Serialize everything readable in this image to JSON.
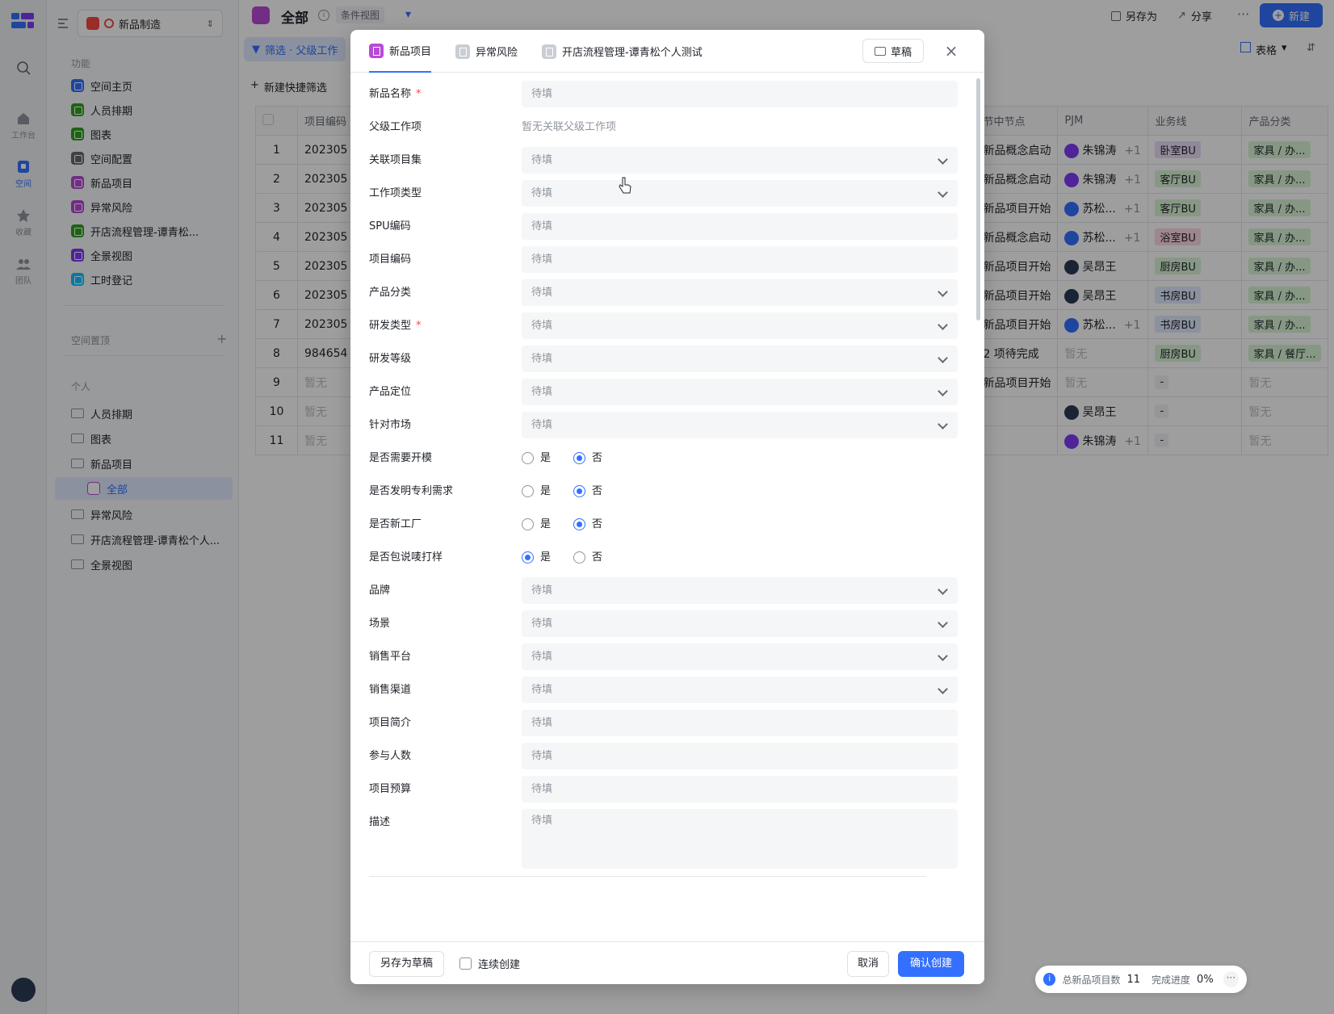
{
  "rail": {
    "items": [
      {
        "label": "工作台"
      },
      {
        "label": "空间"
      },
      {
        "label": "收藏"
      },
      {
        "label": "团队"
      }
    ]
  },
  "sidebar": {
    "workspace": "新品制造",
    "section_features": "功能",
    "features": [
      {
        "label": "空间主页",
        "color": "#3370ff"
      },
      {
        "label": "人员排期",
        "color": "#2ea121"
      },
      {
        "label": "图表",
        "color": "#2ea121"
      },
      {
        "label": "空间配置",
        "color": "#646a73"
      },
      {
        "label": "新品项目",
        "color": "#b84ad6"
      },
      {
        "label": "异常风险",
        "color": "#b84ad6"
      },
      {
        "label": "开店流程管理-谭青松...",
        "color": "#2ea121"
      },
      {
        "label": "全景视图",
        "color": "#7f3bf5"
      },
      {
        "label": "工时登记",
        "color": "#14c0ff"
      }
    ],
    "section_pinned": "空间置顶",
    "section_personal": "个人",
    "personal": [
      {
        "label": "人员排期"
      },
      {
        "label": "图表"
      },
      {
        "label": "新品项目"
      },
      {
        "label": "全部"
      },
      {
        "label": "异常风险"
      },
      {
        "label": "开店流程管理-谭青松个人..."
      },
      {
        "label": "全景视图"
      }
    ]
  },
  "header": {
    "title": "全部",
    "view_tag": "条件视图",
    "save_as": "另存为",
    "share": "分享",
    "new_btn": "新建",
    "filter": "筛选 · 父级工作",
    "quick_filter": "新建快捷筛选",
    "view_mode": "表格"
  },
  "table": {
    "headers": [
      "项目编码",
      "节中节点",
      "PJM",
      "业务线",
      "产品分类"
    ],
    "rows": [
      {
        "n": "1",
        "code": "202305",
        "node": "新品概念启动",
        "pjm": "朱锦涛",
        "plus": "+1",
        "bu": "卧室BU",
        "cat": "家具 / 办..."
      },
      {
        "n": "2",
        "code": "202305",
        "node": "新品概念启动",
        "pjm": "朱锦涛",
        "plus": "+1",
        "bu": "客厅BU",
        "cat": "家具 / 办..."
      },
      {
        "n": "3",
        "code": "202305",
        "node": "新品项目开始",
        "pjm": "苏松...",
        "plus": "+1",
        "bu": "客厅BU",
        "cat": "家具 / 办..."
      },
      {
        "n": "4",
        "code": "202305",
        "node": "新品概念启动",
        "pjm": "苏松...",
        "plus": "+1",
        "bu": "浴室BU",
        "cat": "家具 / 办..."
      },
      {
        "n": "5",
        "code": "202305",
        "node": "新品项目开始",
        "pjm": "吴昂王",
        "plus": "",
        "bu": "厨房BU",
        "cat": "家具 / 办..."
      },
      {
        "n": "6",
        "code": "202305",
        "node": "新品项目开始",
        "pjm": "吴昂王",
        "plus": "",
        "bu": "书房BU",
        "cat": "家具 / 办..."
      },
      {
        "n": "7",
        "code": "202305",
        "node": "新品项目开始",
        "pjm": "苏松...",
        "plus": "+1",
        "bu": "书房BU",
        "cat": "家具 / 办..."
      },
      {
        "n": "8",
        "code": "984654",
        "node": "2 项待完成",
        "pjm": "暂无",
        "plus": "",
        "bu": "厨房BU",
        "cat": "家具 / 餐厅..."
      },
      {
        "n": "9",
        "code": "暂无",
        "node": "新品项目开始",
        "pjm": "暂无",
        "plus": "",
        "bu": "-",
        "cat": "暂无"
      },
      {
        "n": "10",
        "code": "暂无",
        "node": "",
        "pjm": "吴昂王",
        "plus": "",
        "bu": "-",
        "cat": "暂无"
      },
      {
        "n": "11",
        "code": "暂无",
        "node": "",
        "pjm": "朱锦涛",
        "plus": "+1",
        "bu": "-",
        "cat": "暂无"
      }
    ]
  },
  "modal": {
    "tabs": [
      {
        "label": "新品项目",
        "color": "#b84ad6"
      },
      {
        "label": "异常风险",
        "color": "#c9cdd4"
      },
      {
        "label": "开店流程管理-谭青松个人测试",
        "color": "#c9cdd4"
      }
    ],
    "draft": "草稿",
    "placeholder": "待填",
    "fields": [
      {
        "label": "新品名称",
        "type": "text",
        "required": true
      },
      {
        "label": "父级工作项",
        "type": "static",
        "value": "暂无关联父级工作项"
      },
      {
        "label": "关联项目集",
        "type": "select"
      },
      {
        "label": "工作项类型",
        "type": "select"
      },
      {
        "label": "SPU编码",
        "type": "text"
      },
      {
        "label": "项目编码",
        "type": "text"
      },
      {
        "label": "产品分类",
        "type": "select"
      },
      {
        "label": "研发类型",
        "type": "select",
        "required": true
      },
      {
        "label": "研发等级",
        "type": "select"
      },
      {
        "label": "产品定位",
        "type": "select"
      },
      {
        "label": "针对市场",
        "type": "select"
      },
      {
        "label": "是否需要开模",
        "type": "radio",
        "yes": false
      },
      {
        "label": "是否发明专利需求",
        "type": "radio",
        "yes": false
      },
      {
        "label": "是否新工厂",
        "type": "radio",
        "yes": false
      },
      {
        "label": "是否包说唛打样",
        "type": "radio",
        "yes": true
      },
      {
        "label": "品牌",
        "type": "select"
      },
      {
        "label": "场景",
        "type": "select"
      },
      {
        "label": "销售平台",
        "type": "select"
      },
      {
        "label": "销售渠道",
        "type": "select"
      },
      {
        "label": "项目简介",
        "type": "text"
      },
      {
        "label": "参与人数",
        "type": "text"
      },
      {
        "label": "项目预算",
        "type": "text"
      },
      {
        "label": "描述",
        "type": "textarea"
      }
    ],
    "radio_yes": "是",
    "radio_no": "否",
    "save_draft": "另存为草稿",
    "continuous": "连续创建",
    "cancel": "取消",
    "confirm": "确认创建"
  },
  "status": {
    "total_label": "总新品项目数",
    "total": "11",
    "progress_label": "完成进度",
    "progress": "0%"
  }
}
